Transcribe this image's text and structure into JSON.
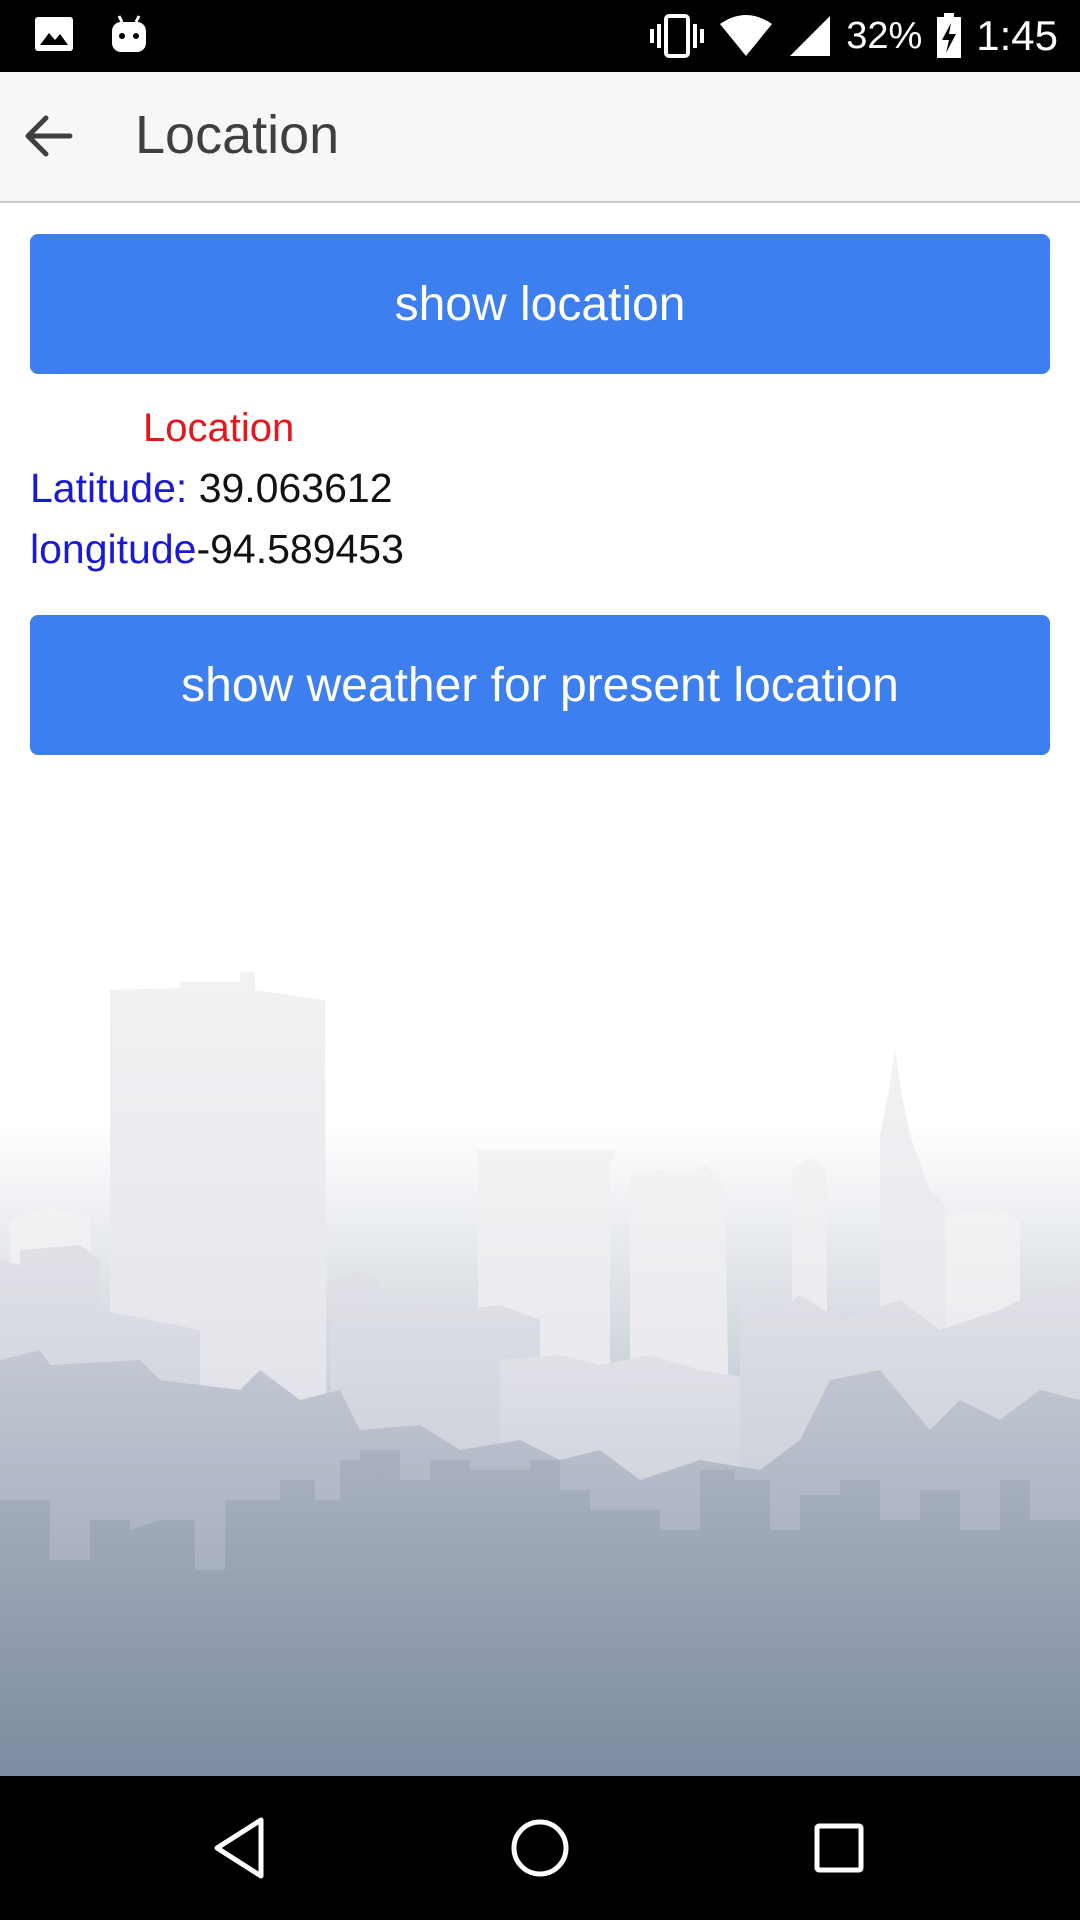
{
  "status_bar": {
    "battery_percent": "32%",
    "time": "1:45",
    "icons": [
      "image-icon",
      "android-icon",
      "vibrate-icon",
      "wifi-icon",
      "signal-icon",
      "battery-charging-icon"
    ]
  },
  "app_bar": {
    "title": "Location",
    "back_icon": "arrow-back-icon"
  },
  "main": {
    "show_location_label": "show location",
    "location_heading": "Location",
    "latitude_label": "Latitude: ",
    "latitude_value": "39.063612",
    "longitude_label": "longitude",
    "longitude_value": "-94.589453",
    "show_weather_label": "show weather for present location"
  },
  "nav_bar": {
    "icons": [
      "back-triangle-icon",
      "home-circle-icon",
      "recents-square-icon"
    ]
  },
  "colors": {
    "button_blue": "#3d7fef",
    "heading_red": "#e8161b",
    "label_blue": "#1919d6"
  }
}
